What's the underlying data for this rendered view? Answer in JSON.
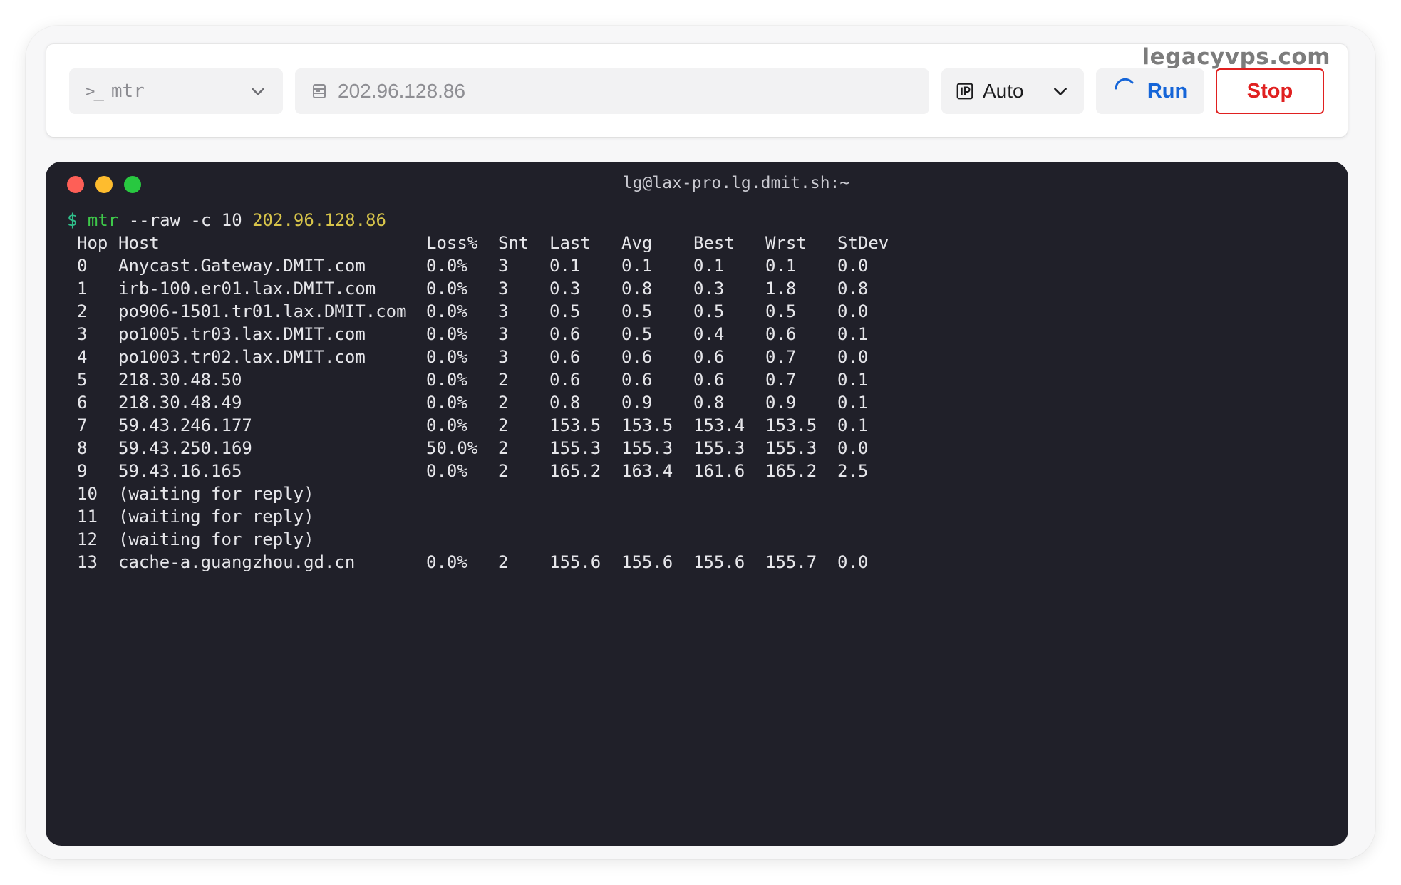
{
  "watermark": "legacyvps.com",
  "toolbar": {
    "tool": "mtr",
    "target_placeholder": "202.96.128.86",
    "ip_version": "Auto",
    "run_label": "Run",
    "stop_label": "Stop"
  },
  "terminal": {
    "title": "lg@lax-pro.lg.dmit.sh:~",
    "prompt_symbol": "$",
    "command_tool": "mtr",
    "command_args": " --raw -c 10 ",
    "command_target": "202.96.128.86",
    "columns": [
      "Hop",
      "Host",
      "Loss%",
      "Snt",
      "Last",
      "Avg",
      "Best",
      "Wrst",
      "StDev"
    ],
    "rows": [
      [
        "0",
        "Anycast.Gateway.DMIT.com",
        "0.0%",
        "3",
        "0.1",
        "0.1",
        "0.1",
        "0.1",
        "0.0"
      ],
      [
        "1",
        "irb-100.er01.lax.DMIT.com",
        "0.0%",
        "3",
        "0.3",
        "0.8",
        "0.3",
        "1.8",
        "0.8"
      ],
      [
        "2",
        "po906-1501.tr01.lax.DMIT.com",
        "0.0%",
        "3",
        "0.5",
        "0.5",
        "0.5",
        "0.5",
        "0.0"
      ],
      [
        "3",
        "po1005.tr03.lax.DMIT.com",
        "0.0%",
        "3",
        "0.6",
        "0.5",
        "0.4",
        "0.6",
        "0.1"
      ],
      [
        "4",
        "po1003.tr02.lax.DMIT.com",
        "0.0%",
        "3",
        "0.6",
        "0.6",
        "0.6",
        "0.7",
        "0.0"
      ],
      [
        "5",
        "218.30.48.50",
        "0.0%",
        "2",
        "0.6",
        "0.6",
        "0.6",
        "0.7",
        "0.1"
      ],
      [
        "6",
        "218.30.48.49",
        "0.0%",
        "2",
        "0.8",
        "0.9",
        "0.8",
        "0.9",
        "0.1"
      ],
      [
        "7",
        "59.43.246.177",
        "0.0%",
        "2",
        "153.5",
        "153.5",
        "153.4",
        "153.5",
        "0.1"
      ],
      [
        "8",
        "59.43.250.169",
        "50.0%",
        "2",
        "155.3",
        "155.3",
        "155.3",
        "155.3",
        "0.0"
      ],
      [
        "9",
        "59.43.16.165",
        "0.0%",
        "2",
        "165.2",
        "163.4",
        "161.6",
        "165.2",
        "2.5"
      ],
      [
        "10",
        "(waiting for reply)",
        "",
        "",
        "",
        "",
        "",
        "",
        ""
      ],
      [
        "11",
        "(waiting for reply)",
        "",
        "",
        "",
        "",
        "",
        "",
        ""
      ],
      [
        "12",
        "(waiting for reply)",
        "",
        "",
        "",
        "",
        "",
        "",
        ""
      ],
      [
        "13",
        "cache-a.guangzhou.gd.cn",
        "0.0%",
        "2",
        "155.6",
        "155.6",
        "155.6",
        "155.7",
        "0.0"
      ]
    ]
  },
  "colors": {
    "terminal_bg": "#202029",
    "run_blue": "#1565d8",
    "stop_red": "#e02020",
    "prompt_green": "#3ec94a",
    "target_yellow": "#d7c44a"
  },
  "icons": {
    "tool_select": "terminal-prompt-icon",
    "target_input": "server-icon",
    "ip_select": "ip-icon",
    "dropdown": "chevron-down-icon",
    "run": "spinner-icon"
  }
}
